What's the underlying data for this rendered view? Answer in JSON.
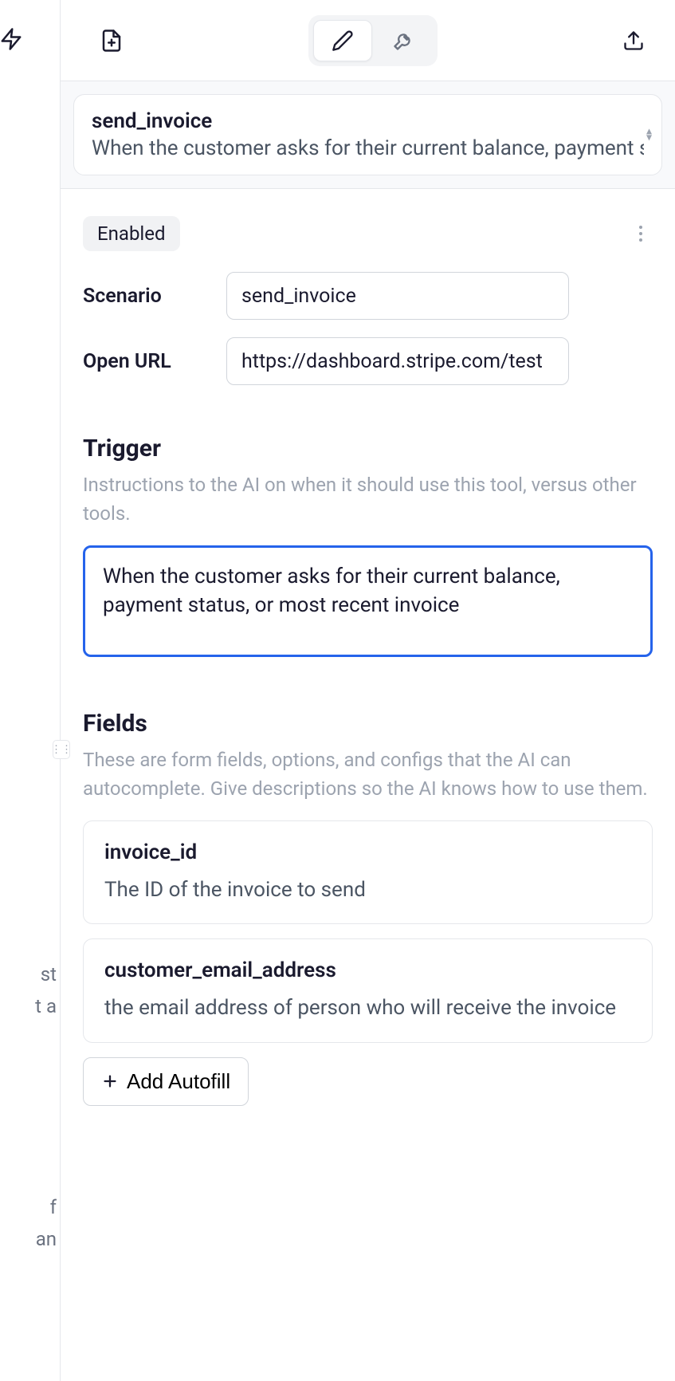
{
  "left_strip": {
    "frag1": "st",
    "frag2": "t a",
    "frag3": "f",
    "frag4": "an"
  },
  "toolbar": {
    "file_icon": "file-plus",
    "edit_icon": "pencil",
    "wrench_icon": "wrench",
    "upload_icon": "upload"
  },
  "header": {
    "title": "send_invoice",
    "description": "When the customer asks for their current balance, payment status, or most recent invoice"
  },
  "status": {
    "enabled_label": "Enabled"
  },
  "form": {
    "scenario_label": "Scenario",
    "scenario_value": "send_invoice",
    "openurl_label": "Open URL",
    "openurl_value": "https://dashboard.stripe.com/test"
  },
  "trigger": {
    "heading": "Trigger",
    "subtext": "Instructions to the AI on when it should use this tool, versus other tools.",
    "value": "When the customer asks for their current balance, payment status, or most recent invoice"
  },
  "fields": {
    "heading": "Fields",
    "subtext": "These are form fields, options, and configs that the AI can autocomplete. Give descriptions so the AI knows how to use them.",
    "items": [
      {
        "name": "invoice_id",
        "desc": "The ID of the invoice to send"
      },
      {
        "name": "customer_email_address",
        "desc": "the email address of person who will receive the invoice"
      }
    ],
    "add_label": "Add Autofill"
  }
}
